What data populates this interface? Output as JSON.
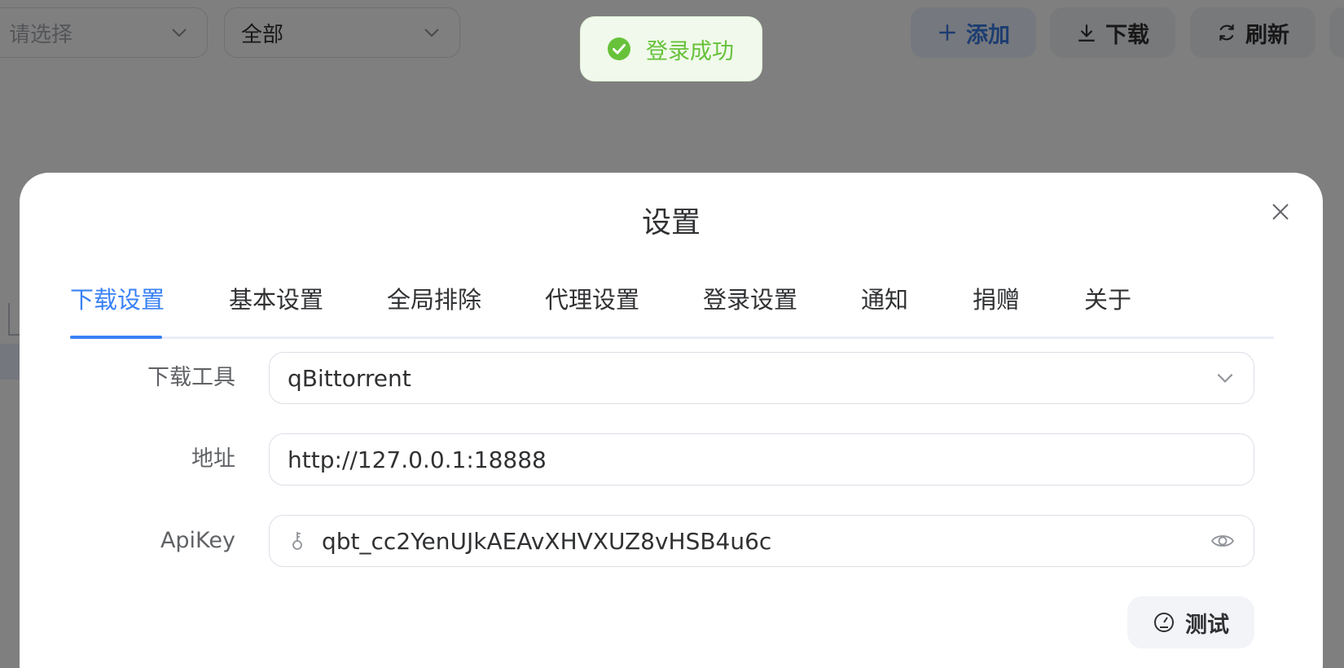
{
  "toolbar": {
    "filter1_placeholder": "请选择",
    "filter2_value": "全部",
    "add_label": "添加",
    "download_label": "下载",
    "refresh_label": "刷新"
  },
  "toast": {
    "message": "登录成功",
    "status": "success",
    "color": "#67c23a"
  },
  "dialog": {
    "title": "设置",
    "tabs": [
      {
        "label": "下载设置",
        "active": true
      },
      {
        "label": "基本设置",
        "active": false
      },
      {
        "label": "全局排除",
        "active": false
      },
      {
        "label": "代理设置",
        "active": false
      },
      {
        "label": "登录设置",
        "active": false
      },
      {
        "label": "通知",
        "active": false
      },
      {
        "label": "捐赠",
        "active": false
      },
      {
        "label": "关于",
        "active": false
      }
    ],
    "fields": {
      "tool": {
        "label": "下载工具",
        "value": "qBittorrent"
      },
      "address": {
        "label": "地址",
        "value": "http://127.0.0.1:18888"
      },
      "apikey": {
        "label": "ApiKey",
        "value": "qbt_cc2YenUJkAEAvXHVXUZ8vHSB4u6c"
      }
    },
    "test_label": "测试"
  },
  "colors": {
    "accent": "#3a82f6",
    "success": "#67c23a",
    "overlay": "rgba(0,0,0,0.5)"
  }
}
